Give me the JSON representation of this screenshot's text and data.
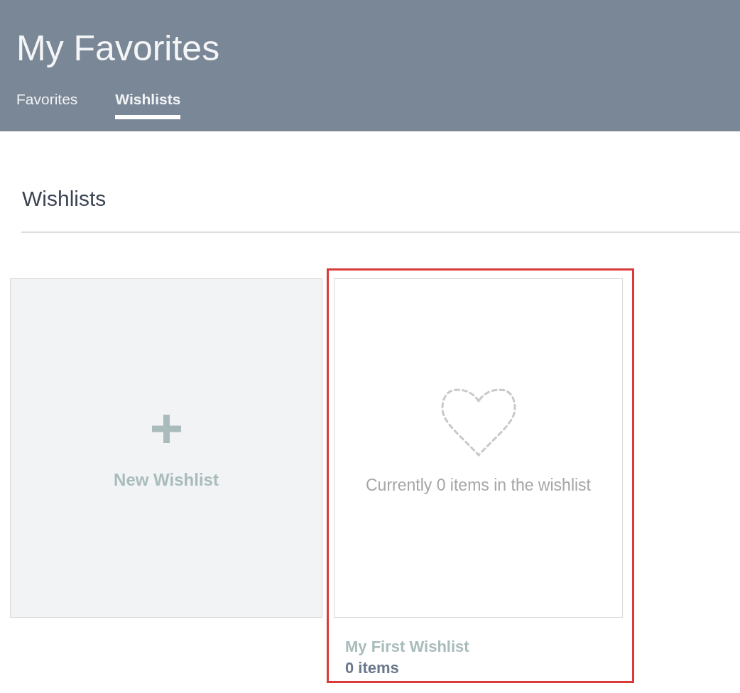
{
  "header": {
    "title": "My Favorites",
    "tabs": [
      {
        "label": "Favorites",
        "selected": false
      },
      {
        "label": "Wishlists",
        "selected": true
      }
    ]
  },
  "section": {
    "heading": "Wishlists"
  },
  "new_wishlist": {
    "label": "New Wishlist"
  },
  "wishlists": [
    {
      "empty_message": "Currently 0 items in the wishlist",
      "name": "My First Wishlist",
      "count": "0 items",
      "highlighted": true
    }
  ]
}
